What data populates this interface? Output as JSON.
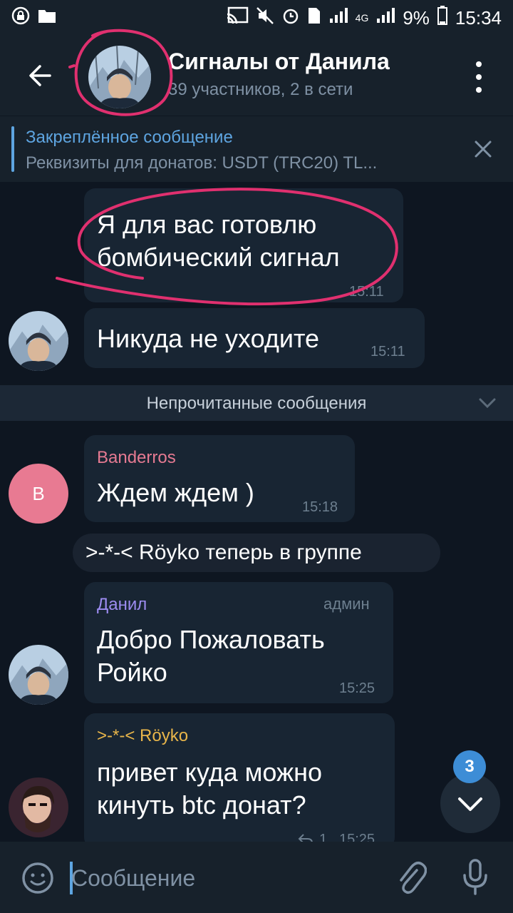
{
  "status_bar": {
    "battery": "9%",
    "time": "15:34",
    "network": "4G"
  },
  "header": {
    "title": "Сигналы от Данила",
    "subtitle": "39 участников, 2 в сети"
  },
  "pinned": {
    "label": "Закреплённое сообщение",
    "text": "Реквизиты для донатов:  USDT (TRC20)  TL..."
  },
  "messages": [
    {
      "lines": [
        "Я для вас готовлю",
        "бомбический сигнал"
      ],
      "time": "15:11"
    },
    {
      "lines": [
        "Никуда не уходите"
      ],
      "time": "15:11"
    },
    {
      "sender": "Banderros",
      "lines": [
        "Ждем ждем )"
      ],
      "time": "15:18",
      "avatar_letter": "B"
    },
    {
      "sender": "Данил",
      "role": "админ",
      "lines": [
        "Добро Пожаловать",
        "Ройко"
      ],
      "time": "15:25"
    },
    {
      "sender": ">-*-< Röyko",
      "lines": [
        "привет куда можно",
        "кинуть btc донат?"
      ],
      "time": "15:25",
      "reply_count": "1"
    }
  ],
  "unread_divider": "Непрочитанные сообщения",
  "service_message": ">-*-< Röyko теперь в группе",
  "scroll_badge": "3",
  "composer": {
    "placeholder": "Сообщение"
  },
  "colors": {
    "background": "#0e1621",
    "bubble": "#182533",
    "accent": "#5ea5e1",
    "banderros_name": "#e67a92",
    "admin_name": "#9c8cf0",
    "royko_name": "#e8b54a",
    "annotation": "#e0306f"
  },
  "icons": [
    "lock-icon",
    "folder-icon",
    "cast-icon",
    "mute-icon",
    "alarm-icon",
    "signal-icon",
    "battery-icon",
    "back-arrow-icon",
    "more-vert-icon",
    "close-icon",
    "chevron-down-icon",
    "emoji-icon",
    "attach-icon",
    "mic-icon",
    "reply-icon"
  ]
}
